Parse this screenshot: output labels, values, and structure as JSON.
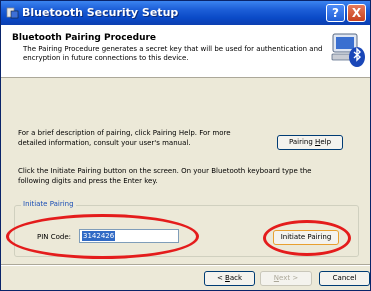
{
  "window": {
    "title": "Bluetooth Security Setup",
    "help_label": "?",
    "close_label": "X"
  },
  "header": {
    "title": "Bluetooth Pairing Procedure",
    "description": "The Pairing Procedure generates a secret key that will be used for authentication and encryption in future connections to this device."
  },
  "body": {
    "paragraph1": "For a brief description of pairing, click Pairing Help.  For more detailed information, consult your user's manual.",
    "paragraph2": "Click the Initiate Pairing button on the screen.  On your Bluetooth keyboard type the following digits and press the Enter key."
  },
  "pairing_help_button": {
    "label_pre": "Pairing ",
    "label_key": "H",
    "label_post": "elp"
  },
  "initiate_group": {
    "label": "Initiate Pairing",
    "pin_label": "PIN Code:",
    "pin_value": "3142426",
    "button_label": "Initiate Pairing"
  },
  "footer": {
    "back_pre": "< ",
    "back_key": "B",
    "back_post": "ack",
    "next_pre": "",
    "next_key": "N",
    "next_post": "ext >",
    "cancel_label": "Cancel"
  },
  "colors": {
    "titlebar": "#0a4ac8",
    "annotation": "#e41c1c",
    "selection": "#316ac5"
  }
}
